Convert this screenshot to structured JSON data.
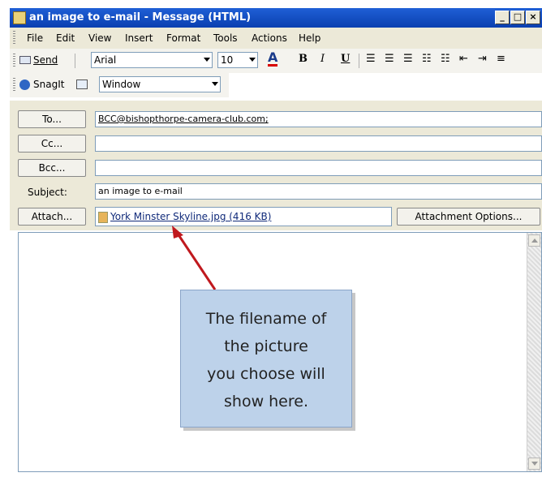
{
  "window": {
    "title": "an image to e-mail - Message (HTML)",
    "minimize": "_",
    "maximize": "□",
    "close": "×"
  },
  "menu": [
    {
      "label": "File"
    },
    {
      "label": "Edit"
    },
    {
      "label": "View"
    },
    {
      "label": "Insert"
    },
    {
      "label": "Format"
    },
    {
      "label": "Tools"
    },
    {
      "label": "Actions"
    },
    {
      "label": "Help"
    }
  ],
  "format_toolbar": {
    "send_label": "Send",
    "font": "Arial",
    "size": "10",
    "bold": "B",
    "italic": "I",
    "underline": "U",
    "font_color": "A"
  },
  "snagit_toolbar": {
    "snagit_label": "SnagIt",
    "capture_mode": "Window"
  },
  "form": {
    "to_button": "To...",
    "to_value": "BCC@bishopthorpe-camera-club.com;",
    "cc_button": "Cc...",
    "cc_value": "",
    "bcc_button": "Bcc...",
    "bcc_value": "",
    "subject_label": "Subject:",
    "subject_value": "an image to e-mail",
    "attach_button": "Attach...",
    "attachment": "York Minster Skyline.jpg (416 KB)",
    "attachment_options": "Attachment Options..."
  },
  "callout": {
    "lines": [
      "The filename of",
      "the picture",
      "you choose will",
      "show here."
    ]
  },
  "colors": {
    "titlebar": "#0a3fb0",
    "callout_fill": "#bdd2ea",
    "arrow": "#c0191e"
  },
  "icons": [
    "app-envelope-icon",
    "send-icon",
    "snagit-icon",
    "image-file-icon"
  ]
}
